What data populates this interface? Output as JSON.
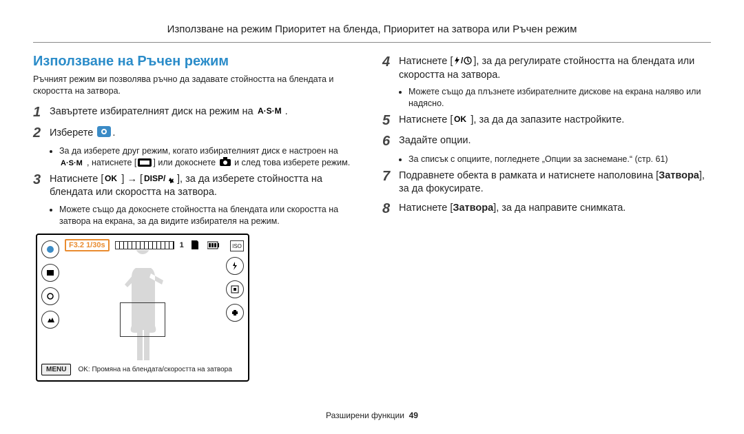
{
  "header": "Използване на режим Приоритет на бленда, Приоритет на затвора или Ръчен режим",
  "section_title": "Използване на Ръчен режим",
  "intro": "Ръчният режим ви позволява ръчно да задавате стойността на блендата и скоростта на затвора.",
  "left": {
    "step1": "Завъртете избирателният диск на режим на",
    "step1_icon_alt": "A·S·M",
    "step1_end": ".",
    "step2": "Изберете",
    "step2_icon_alt": "ръчен режим",
    "step2_end": ".",
    "sub1_a": "За да изберете друг режим, когато избирателният диск е настроен на",
    "sub1_b": ", натиснете [",
    "sub1_c": "] или докоснете",
    "sub1_d": "и след това изберете режим.",
    "step3_a": "Натиснете [",
    "step3_b": "] → [",
    "step3_c": "], за да изберете стойността на блендата или скоростта на затвора.",
    "sub3": "Можете също да докоснете стойността на блендата или скоростта на затвора на екрана, за да видите избирателя на режим."
  },
  "right": {
    "step4_a": "Натиснете [",
    "step4_b": "], за да регулирате стойността на блендата или скоростта на затвора.",
    "sub4": "Можете също да плъзнете избирателните дискове на екрана наляво или надясно.",
    "step5_a": "Натиснете [",
    "step5_b": "], за да да запазите настройките.",
    "step6": "Задайте опции.",
    "sub6": "За списък с опциите, погледнете „Опции за заснемане.“ (стр. 61)",
    "step7_a": "Подравнете обекта в рамката и натиснете наполовина [",
    "step7_b": "Затвора",
    "step7_c": "], за да фокусирате.",
    "step8_a": "Натиснете [",
    "step8_b": "Затвора",
    "step8_c": "], за да направите снимката."
  },
  "lcd": {
    "f_value": "F3.2 1/30s",
    "count": "1",
    "menu": "MENU",
    "bar_text": "OK: Промяна на блендата/скоростта на затвора",
    "iso": "ISO"
  },
  "footer": {
    "label": "Разширени функции",
    "page": "49"
  }
}
